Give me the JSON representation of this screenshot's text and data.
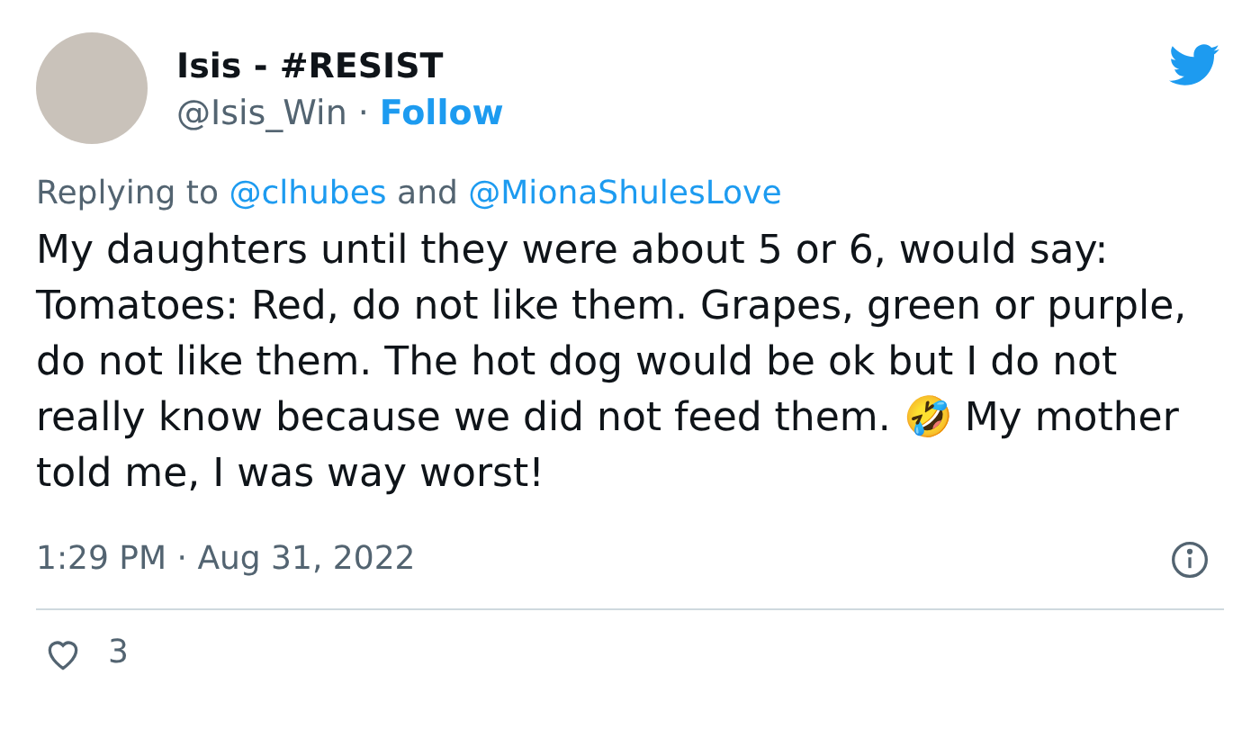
{
  "author": {
    "name": "Isis - #RESIST",
    "handle": "@Isis_Win",
    "separator": "·",
    "follow": "Follow"
  },
  "reply": {
    "prefix": "Replying to",
    "mentions": [
      "@clhubes",
      "@MionaShulesLove"
    ],
    "joiner": "and"
  },
  "body": "My daughters until they were about 5 or 6, would say: Tomatoes: Red, do not like them. Grapes, green or purple, do not like them. The hot dog would be ok but I do not really know because we did not feed them. 🤣 My mother told me, I was way worst!",
  "timestamp": "1:29 PM · Aug 31, 2022",
  "likes": {
    "count": "3",
    "liked": false
  }
}
